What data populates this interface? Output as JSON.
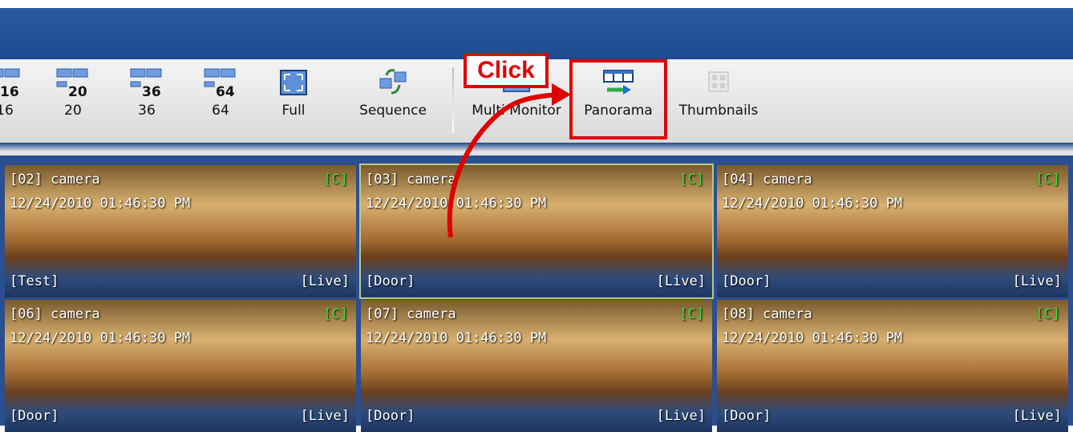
{
  "toolbar": {
    "buttons": [
      {
        "id": "16",
        "icon": "layout-16-icon",
        "num": "16",
        "label": "16"
      },
      {
        "id": "20",
        "icon": "layout-20-icon",
        "num": "20",
        "label": "20"
      },
      {
        "id": "36",
        "icon": "layout-36-icon",
        "num": "36",
        "label": "36"
      },
      {
        "id": "64",
        "icon": "layout-64-icon",
        "num": "64",
        "label": "64"
      },
      {
        "id": "full",
        "icon": "fullscreen-icon",
        "label": "Full"
      },
      {
        "id": "sequence",
        "icon": "sequence-icon",
        "label": "Sequence"
      },
      {
        "id": "multi",
        "icon": "multi-monitor-icon",
        "label": "Multi Monitor"
      },
      {
        "id": "panorama",
        "icon": "panorama-icon",
        "label": "Panorama"
      },
      {
        "id": "thumbnails",
        "icon": "thumbnails-icon",
        "label": "Thumbnails"
      }
    ]
  },
  "annotation": {
    "callout": "Click",
    "highlight_color": "#e00000"
  },
  "cameras": [
    {
      "name": "[02] camera",
      "time": "12/24/2010 01:46:30 PM",
      "flag": "[C]",
      "tag": "[Test]",
      "status": "[Live]"
    },
    {
      "name": "[03] camera",
      "time": "12/24/2010 01:46:30 PM",
      "flag": "[C]",
      "tag": "[Door]",
      "status": "[Live]"
    },
    {
      "name": "[04] camera",
      "time": "12/24/2010 01:46:30 PM",
      "flag": "[C]",
      "tag": "[Door]",
      "status": "[Live]"
    },
    {
      "name": "[06] camera",
      "time": "12/24/2010 01:46:30 PM",
      "flag": "[C]",
      "tag": "[Door]",
      "status": "[Live]"
    },
    {
      "name": "[07] camera",
      "time": "12/24/2010 01:46:30 PM",
      "flag": "[C]",
      "tag": "[Door]",
      "status": "[Live]"
    },
    {
      "name": "[08] camera",
      "time": "12/24/2010 01:46:30 PM",
      "flag": "[C]",
      "tag": "[Door]",
      "status": "[Live]"
    }
  ],
  "colors": {
    "titlebar": "#1f4a8f",
    "grid_bg": "#2c4f8f",
    "flag": "#39e639"
  }
}
